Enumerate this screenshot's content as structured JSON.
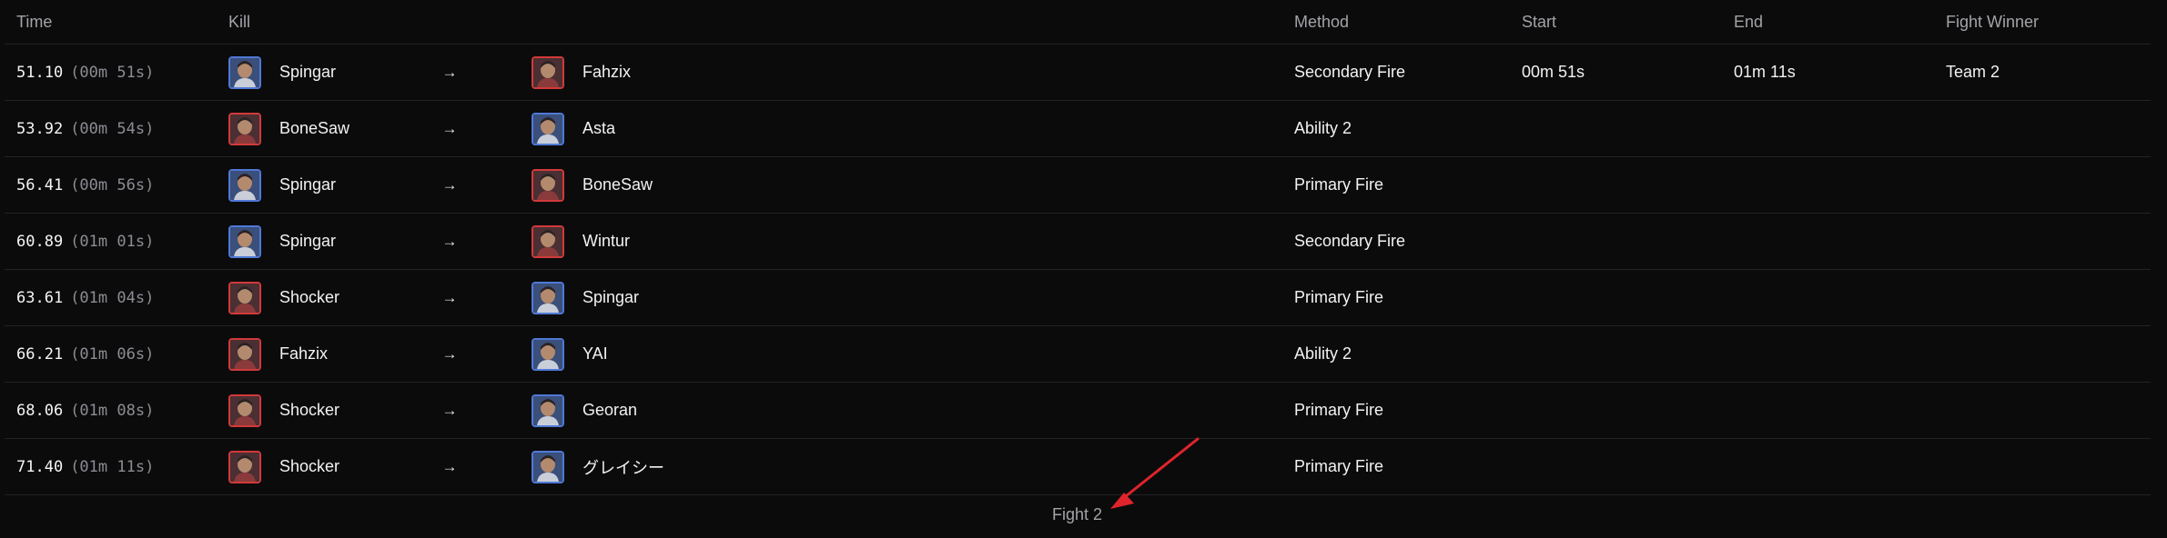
{
  "table": {
    "headers": {
      "time": "Time",
      "kill": "Kill",
      "method": "Method",
      "start": "Start",
      "end": "End",
      "winner": "Fight Winner"
    },
    "rows": [
      {
        "time": "51.10",
        "time_sub": "(00m 51s)",
        "killer": "Spingar",
        "killer_icon": "hero-portrait-icon",
        "killer_team_color": "#4f79d6",
        "victim": "Fahzix",
        "victim_icon": "hero-portrait-icon",
        "victim_team_color": "#d23a3a",
        "method": "Secondary Fire",
        "start": "00m 51s",
        "end": "01m 11s",
        "winner": "Team 2"
      },
      {
        "time": "53.92",
        "time_sub": "(00m 54s)",
        "killer": "BoneSaw",
        "killer_icon": "hero-portrait-icon",
        "killer_team_color": "#d23a3a",
        "victim": "Asta",
        "victim_icon": "hero-portrait-icon",
        "victim_team_color": "#4f79d6",
        "method": "Ability 2",
        "start": "",
        "end": "",
        "winner": ""
      },
      {
        "time": "56.41",
        "time_sub": "(00m 56s)",
        "killer": "Spingar",
        "killer_icon": "hero-portrait-icon",
        "killer_team_color": "#4f79d6",
        "victim": "BoneSaw",
        "victim_icon": "hero-portrait-icon",
        "victim_team_color": "#d23a3a",
        "method": "Primary Fire",
        "start": "",
        "end": "",
        "winner": ""
      },
      {
        "time": "60.89",
        "time_sub": "(01m 01s)",
        "killer": "Spingar",
        "killer_icon": "hero-portrait-icon",
        "killer_team_color": "#4f79d6",
        "victim": "Wintur",
        "victim_icon": "hero-portrait-icon",
        "victim_team_color": "#d23a3a",
        "method": "Secondary Fire",
        "start": "",
        "end": "",
        "winner": ""
      },
      {
        "time": "63.61",
        "time_sub": "(01m 04s)",
        "killer": "Shocker",
        "killer_icon": "hero-portrait-icon",
        "killer_team_color": "#d23a3a",
        "victim": "Spingar",
        "victim_icon": "hero-portrait-icon",
        "victim_team_color": "#4f79d6",
        "method": "Primary Fire",
        "start": "",
        "end": "",
        "winner": ""
      },
      {
        "time": "66.21",
        "time_sub": "(01m 06s)",
        "killer": "Fahzix",
        "killer_icon": "hero-portrait-icon",
        "killer_team_color": "#d23a3a",
        "victim": "YAI",
        "victim_icon": "hero-portrait-icon",
        "victim_team_color": "#4f79d6",
        "method": "Ability 2",
        "start": "",
        "end": "",
        "winner": ""
      },
      {
        "time": "68.06",
        "time_sub": "(01m 08s)",
        "killer": "Shocker",
        "killer_icon": "hero-portrait-icon",
        "killer_team_color": "#d23a3a",
        "victim": "Georan",
        "victim_icon": "hero-portrait-icon",
        "victim_team_color": "#4f79d6",
        "method": "Primary Fire",
        "start": "",
        "end": "",
        "winner": ""
      },
      {
        "time": "71.40",
        "time_sub": "(01m 11s)",
        "killer": "Shocker",
        "killer_icon": "hero-portrait-icon",
        "killer_team_color": "#d23a3a",
        "victim": "グレイシー",
        "victim_icon": "hero-portrait-icon",
        "victim_team_color": "#4f79d6",
        "method": "Primary Fire",
        "start": "",
        "end": "",
        "winner": ""
      }
    ],
    "arrow_icon": "right-arrow-icon",
    "arrow_glyph": "→"
  },
  "footer": {
    "fight_label": "Fight 2"
  },
  "annotation": {
    "icon": "red-arrow-annotation-icon",
    "color": "#e0242b"
  }
}
